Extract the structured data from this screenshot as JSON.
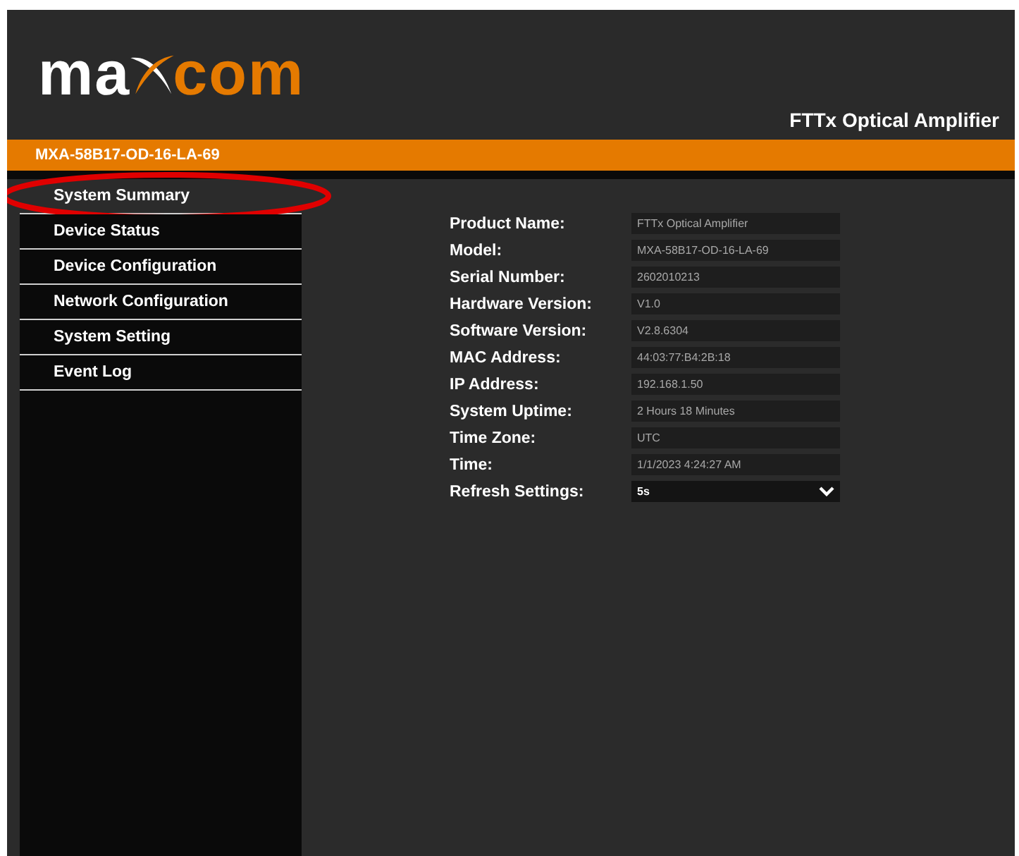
{
  "logo": {
    "left": "ma",
    "right": "com"
  },
  "header": {
    "title": "FTTx Optical Amplifier"
  },
  "device_bar": {
    "label": "MXA-58B17-OD-16-LA-69"
  },
  "sidebar": {
    "items": [
      {
        "label": "System Summary",
        "selected": true,
        "circled": true
      },
      {
        "label": "Device Status",
        "selected": false,
        "circled": false
      },
      {
        "label": "Device Configuration",
        "selected": false,
        "circled": false
      },
      {
        "label": "Network Configuration",
        "selected": false,
        "circled": false
      },
      {
        "label": "System Setting",
        "selected": false,
        "circled": false
      },
      {
        "label": "Event Log",
        "selected": false,
        "circled": false
      }
    ]
  },
  "summary": {
    "rows": [
      {
        "kind": "field",
        "label": "Product Name:",
        "value": "FTTx Optical Amplifier"
      },
      {
        "kind": "field",
        "label": "Model:",
        "value": "MXA-58B17-OD-16-LA-69"
      },
      {
        "kind": "field",
        "label": "Serial Number:",
        "value": "2602010213"
      },
      {
        "kind": "field",
        "label": "Hardware Version:",
        "value": "V1.0"
      },
      {
        "kind": "field",
        "label": "Software Version:",
        "value": "V2.8.6304"
      },
      {
        "kind": "field",
        "label": "MAC Address:",
        "value": "44:03:77:B4:2B:18"
      },
      {
        "kind": "field",
        "label": "IP Address:",
        "value": "192.168.1.50"
      },
      {
        "kind": "field",
        "label": "System Uptime:",
        "value": "2 Hours 18 Minutes"
      },
      {
        "kind": "field",
        "label": "Time Zone:",
        "value": "UTC"
      },
      {
        "kind": "field",
        "label": "Time:",
        "value": "1/1/2023 4:24:27 AM"
      },
      {
        "kind": "select",
        "label": "Refresh Settings:",
        "value": "5s"
      }
    ]
  }
}
